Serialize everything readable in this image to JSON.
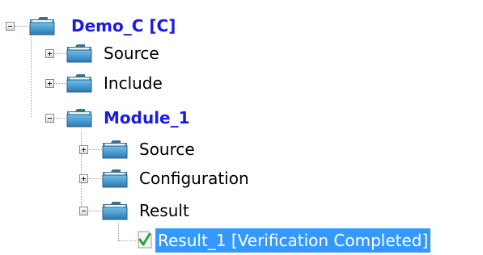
{
  "tree": {
    "root": {
      "label": "Demo_C [C]",
      "expander": "collapse",
      "icon": "folder-icon"
    },
    "root_children": [
      {
        "label": "Source",
        "expander": "expand",
        "icon": "folder-icon"
      },
      {
        "label": "Include",
        "expander": "expand",
        "icon": "folder-icon"
      },
      {
        "label": "Module_1",
        "expander": "collapse",
        "icon": "folder-icon"
      }
    ],
    "module_children": [
      {
        "label": "Source",
        "expander": "expand",
        "icon": "folder-icon"
      },
      {
        "label": "Configuration",
        "expander": "expand",
        "icon": "folder-icon"
      },
      {
        "label": "Result",
        "expander": "collapse",
        "icon": "folder-icon"
      }
    ],
    "result_children": [
      {
        "label": "Result_1 [Verification Completed]",
        "icon": "checkmark-icon",
        "selected": true
      }
    ]
  },
  "colors": {
    "bold_label": "#1a1ae6",
    "selection": "#3399ff",
    "folder_front": "#3a8fc6",
    "check": "#2ea043"
  }
}
